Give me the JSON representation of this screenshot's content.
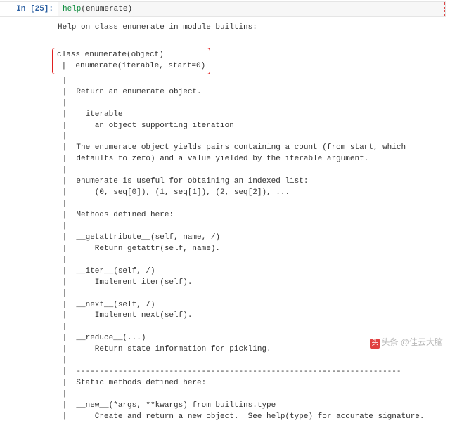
{
  "cell": {
    "prompt": "In [25]:",
    "code_fn": "help",
    "code_arg": "enumerate"
  },
  "help": {
    "header": "Help on class enumerate in module builtins:",
    "sig1": "class enumerate(object)",
    "sig2": " |  enumerate(iterable, start=0)",
    "body": [
      " |",
      " |  Return an enumerate object.",
      " |",
      " |    iterable",
      " |      an object supporting iteration",
      " |",
      " |  The enumerate object yields pairs containing a count (from start, which",
      " |  defaults to zero) and a value yielded by the iterable argument.",
      " |",
      " |  enumerate is useful for obtaining an indexed list:",
      " |      (0, seq[0]), (1, seq[1]), (2, seq[2]), ...",
      " |",
      " |  Methods defined here:",
      " |",
      " |  __getattribute__(self, name, /)",
      " |      Return getattr(self, name).",
      " |",
      " |  __iter__(self, /)",
      " |      Implement iter(self).",
      " |",
      " |  __next__(self, /)",
      " |      Implement next(self).",
      " |",
      " |  __reduce__(...)",
      " |      Return state information for pickling.",
      " |",
      " |  ----------------------------------------------------------------------",
      " |  Static methods defined here:",
      " |",
      " |  __new__(*args, **kwargs) from builtins.type",
      " |      Create and return a new object.  See help(type) for accurate signature."
    ]
  },
  "watermark": {
    "logo": "头",
    "text": "头条 @佳云大脑"
  }
}
